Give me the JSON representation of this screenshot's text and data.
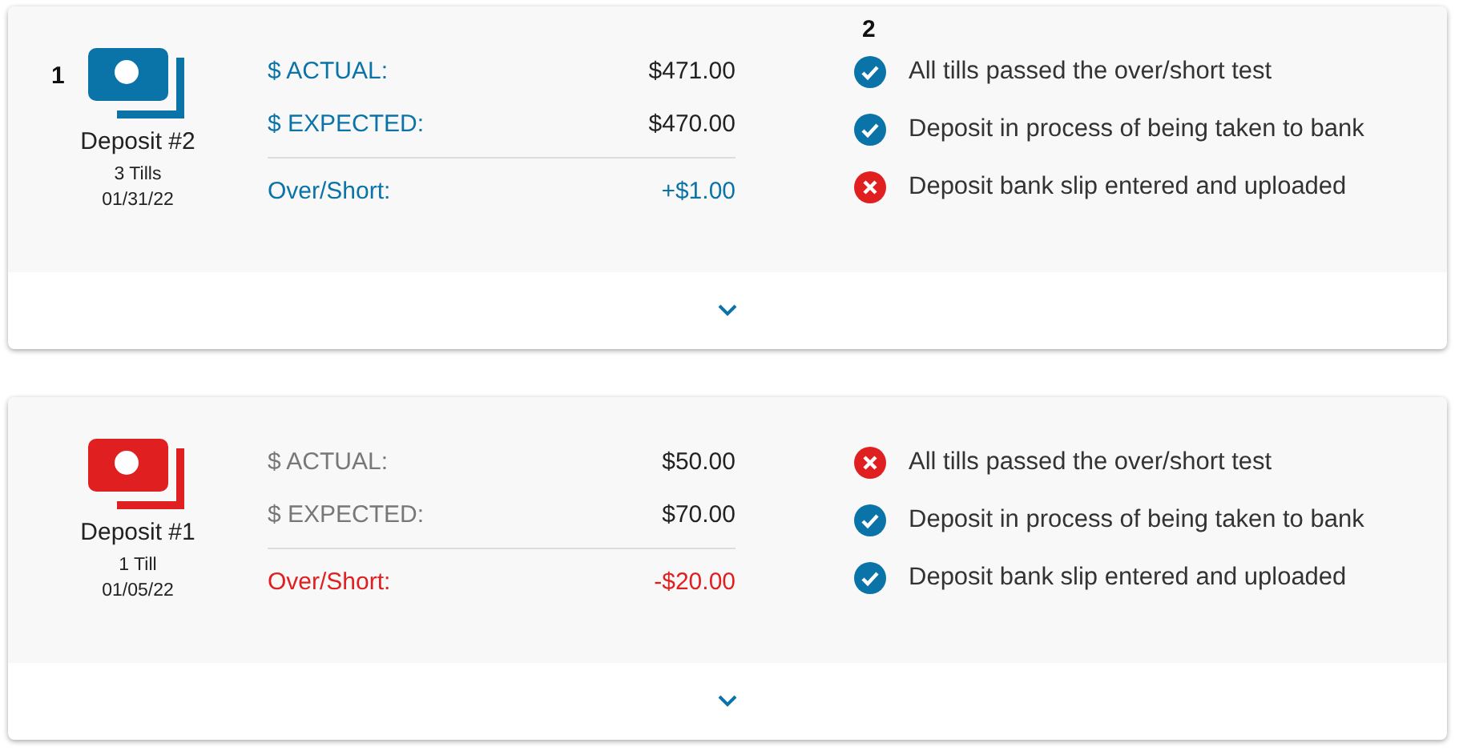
{
  "deposits": [
    {
      "callouts": [
        "1",
        "2"
      ],
      "short": false,
      "title": "Deposit #2",
      "tills": "3 Tills",
      "date": "01/31/22",
      "actual_label": "$ ACTUAL:",
      "actual": "$471.00",
      "expected_label": "$ EXPECTED:",
      "expected": "$470.00",
      "diff_label": "Over/Short:",
      "diff": "+$1.00",
      "checks": [
        {
          "text": "All tills passed the over/short test",
          "passed": true
        },
        {
          "text": "Deposit in process of being taken to bank",
          "passed": true
        },
        {
          "text": "Deposit bank slip entered and uploaded",
          "passed": false
        }
      ]
    },
    {
      "short": true,
      "title": "Deposit #1",
      "tills": "1 Till",
      "date": "01/05/22",
      "actual_label": "$ ACTUAL:",
      "actual": "$50.00",
      "expected_label": "$ EXPECTED:",
      "expected": "$70.00",
      "diff_label": "Over/Short:",
      "diff": "-$20.00",
      "checks": [
        {
          "text": "All tills passed the over/short test",
          "passed": false
        },
        {
          "text": "Deposit in process of being taken to bank",
          "passed": true
        },
        {
          "text": "Deposit bank slip entered and uploaded",
          "passed": true
        }
      ]
    }
  ]
}
